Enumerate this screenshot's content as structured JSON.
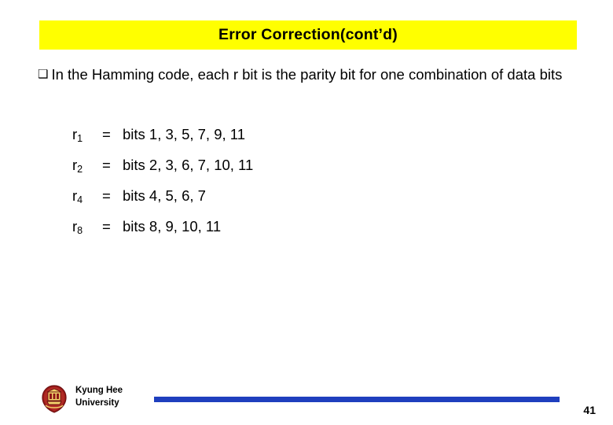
{
  "slide": {
    "title": "Error Correction(cont’d)",
    "title_bg_color": "#ffff00",
    "bullet": {
      "marker": "❑",
      "text": "In the Hamming code, each r bit is the parity bit for one combination of data bits"
    },
    "equations": [
      {
        "label": "r",
        "subscript": "1",
        "equals": "=",
        "value": "bits 1, 3, 5, 7, 9, 11"
      },
      {
        "label": "r",
        "subscript": "2",
        "equals": "=",
        "value": "bits 2, 3, 6, 7, 10, 11"
      },
      {
        "label": "r",
        "subscript": "4",
        "equals": "=",
        "value": "bits 4, 5, 6, 7"
      },
      {
        "label": "r",
        "subscript": "8",
        "equals": "=",
        "value": "bits 8, 9, 10, 11"
      }
    ],
    "footer": {
      "org_line1": "Kyung Hee",
      "org_line2": "University",
      "rule_color": "#1f3fbe",
      "page_number": "41"
    }
  }
}
